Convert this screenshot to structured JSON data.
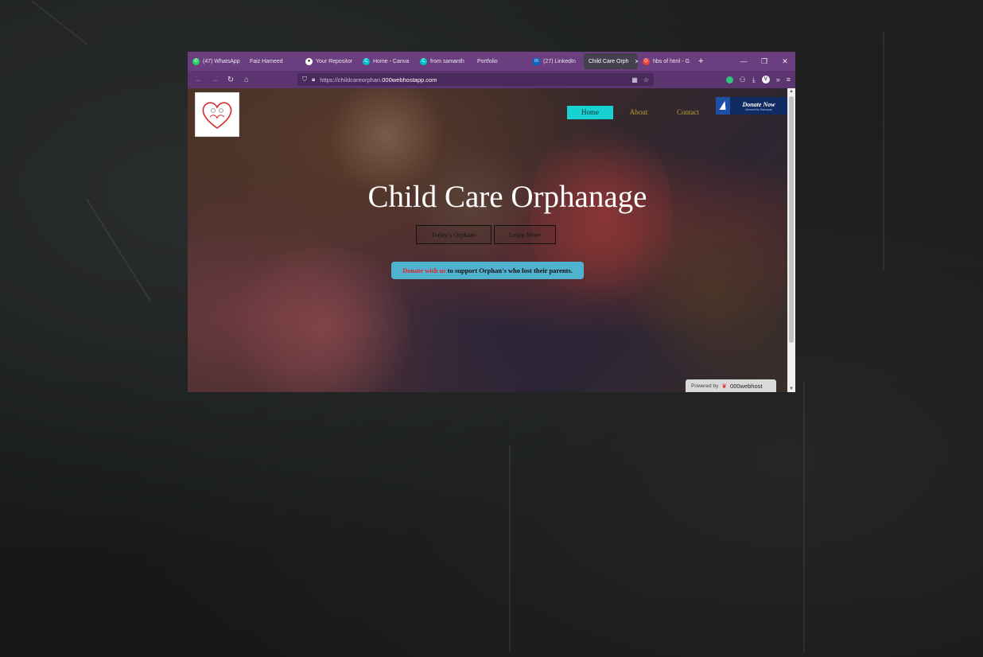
{
  "browser": {
    "tabs": [
      {
        "label": "(47) WhatsApp",
        "icon": "whatsapp-icon",
        "icon_color": "#25d366",
        "active": false
      },
      {
        "label": "Faiz Hameed",
        "icon": "",
        "icon_color": "",
        "active": false
      },
      {
        "label": "Your Repositor",
        "icon": "github-icon",
        "icon_color": "#ffffff",
        "active": false
      },
      {
        "label": "Home - Canva",
        "icon": "canva-icon",
        "icon_color": "#00c4cc",
        "active": false
      },
      {
        "label": "from samanth",
        "icon": "canva-icon",
        "icon_color": "#00c4cc",
        "active": false
      },
      {
        "label": "Portfolio",
        "icon": "",
        "icon_color": "",
        "active": false
      },
      {
        "label": "(27) LinkedIn",
        "icon": "linkedin-icon",
        "icon_color": "#0a66c2",
        "active": false
      },
      {
        "label": "Child Care Orph",
        "icon": "",
        "icon_color": "",
        "active": true
      },
      {
        "label": "hbs of html - G",
        "icon": "google-icon",
        "icon_color": "#ea4335",
        "active": false
      }
    ],
    "url_prefix": "https://childcareorphan.",
    "url_domain": "000webhostapp.com"
  },
  "site": {
    "nav": {
      "home": "Home",
      "about": "About",
      "contact": "Contact"
    },
    "donate_button": {
      "title": "Donate Now",
      "subtitle": "Secured by Razorpay"
    },
    "hero_title": "Child Care Orphanage",
    "buttons": {
      "orphans": "Today's Orphans",
      "learn_more": "Learn More"
    },
    "banner": {
      "highlight": "Donate with us",
      "rest": " to support Orphan's who lost their parents."
    },
    "powered": {
      "label": "Powered by",
      "brand": "000webhost"
    }
  },
  "colors": {
    "tabbar": "#6b3f7f",
    "nav_active": "#18d2d2",
    "nav_link": "#b8a12c",
    "banner_bg": "#4fb3cf",
    "banner_highlight": "#e0242a",
    "donate_bg": "#102a62"
  }
}
